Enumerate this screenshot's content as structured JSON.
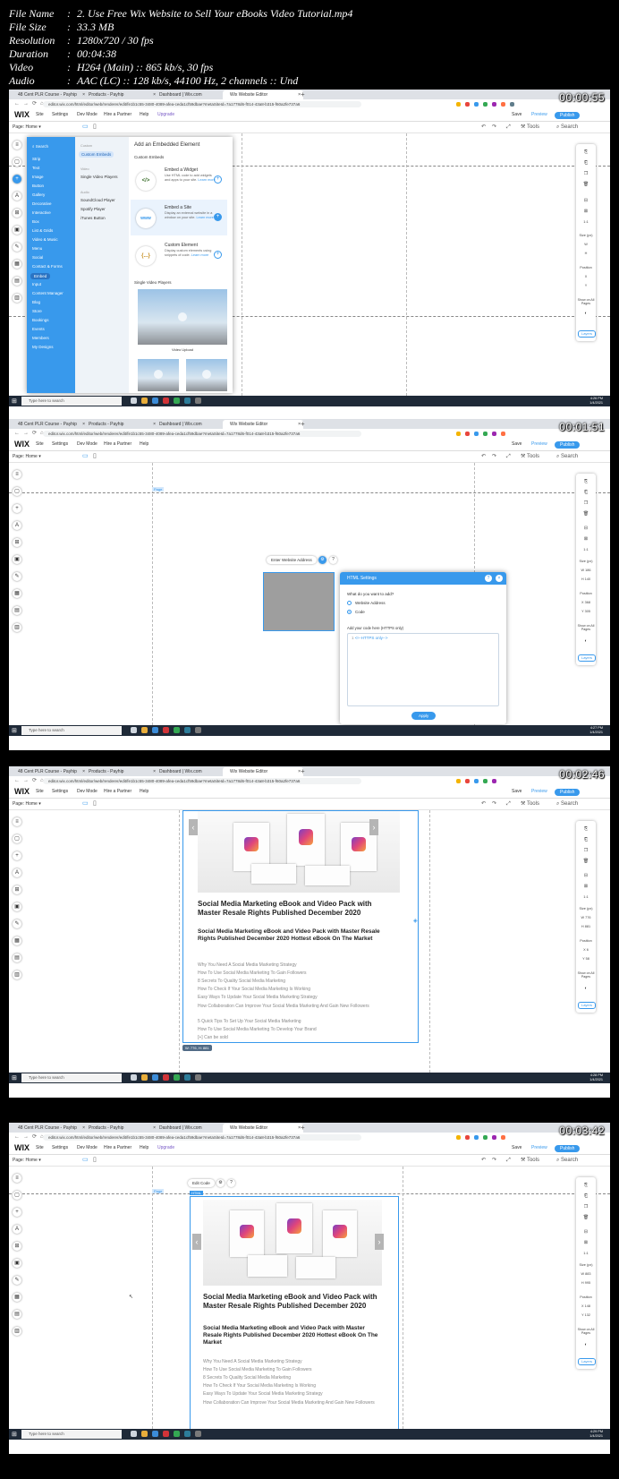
{
  "meta": {
    "file_name": "2. Use Free Wix Website to Sell Your eBooks Video Tutorial.mp4",
    "file_size": "33.3 MB",
    "resolution": "1280x720 / 30 fps",
    "duration": "00:04:38",
    "video": "H264 (Main) :: 865 kb/s, 30 fps",
    "audio": "AAC (LC) :: 128 kb/s, 44100 Hz, 2 channels :: Und",
    "labels": {
      "file_name": "File Name",
      "file_size": "File Size",
      "resolution": "Resolution",
      "duration": "Duration",
      "video": "Video",
      "audio": "Audio"
    }
  },
  "browser": {
    "tabs": [
      "48 Cent PLR Course - Payhip",
      "Products - Payhip",
      "Dashboard | Wix.com",
      "Wix Website Editor"
    ],
    "url_1": "editor.wix.com/html/editor/web/renderer/edit/fe1b1c55-3480-4089-afea-ceda1cf59dbae?metaSiteId=7a1778d6-f014-43a8-b315-f60a2fe737a6",
    "url_2": "editor.wix.com/html/editor/web/renderer/edit/fe1b1c55-3480-4089-afea-ceda1cf59dbae?metaSiteId=7a1778d6-f014-43a8-b315-f60a2fe737a6",
    "url_3": "editor.wix.com/html/editor/web/renderer/edit/fe1b1c55-3480-4089-afea-ceda1cf59dbae?metaSiteId=7a1778d6-f014-43a8-b315-f60a2fe737a6",
    "url_4": "editor.wix.com/html/editor/web/renderer/edit/fe1b1c55-3480-4089-afea-ceda1cf59dbae?metaSiteId=7a1778d6-f014-43a8-b315-f60a2fe737a6"
  },
  "wix": {
    "logo": "WIX",
    "menu": [
      "Site",
      "Settings",
      "Dev Mode",
      "Hire a Partner",
      "Help",
      "Upgrade"
    ],
    "save": "Save",
    "preview": "Preview",
    "publish": "Publish",
    "page_label": "Page:",
    "page_name": "Home",
    "tools": "Tools",
    "search": "Search",
    "page_tag": "Page",
    "html_tag": "HTML"
  },
  "add_panel": {
    "search": "Search",
    "categories": [
      "Strip",
      "Text",
      "Image",
      "Button",
      "Gallery",
      "Decorative",
      "Interactive",
      "Box",
      "List & Grids",
      "Video & Music",
      "Menu",
      "Social",
      "Contact & Forms",
      "Embed",
      "Input",
      "Content Manager",
      "Blog",
      "Store",
      "Bookings",
      "Events",
      "Members",
      "My Designs"
    ],
    "selected_category": "Embed",
    "sub_heads": [
      "Custom",
      "Video",
      "Audio"
    ],
    "sub_items": [
      "Custom Embeds",
      "Single Video Players",
      "SoundCloud Player",
      "Spotify Player",
      "iTunes Button"
    ],
    "title": "Add an Embedded Element",
    "section_custom": "Custom Embeds",
    "cards": [
      {
        "title": "Embed a Widget",
        "desc": "Use HTML code to add widgets and apps to your site.",
        "more": "Learn more"
      },
      {
        "title": "Embed a Site",
        "desc": "Display an external website in a window on your site.",
        "more": "Learn more"
      },
      {
        "title": "Custom Element",
        "desc": "Display custom elements using snippets of code.",
        "more": "Learn more"
      }
    ],
    "section_video": "Single Video Players",
    "video_caption": "Video Upload"
  },
  "inspector": {
    "size_label": "Size (px)",
    "w_label": "W",
    "h_label": "H",
    "position_label": "Position",
    "x_label": "X",
    "y_label": "Y",
    "show_all_pages": "Show on All Pages",
    "layers": "Layers",
    "ratio": "1:1",
    "frame2": {
      "w": "186",
      "h": "140",
      "x": "368",
      "y": "305"
    },
    "frame3": {
      "w": "776",
      "h": "881",
      "x": "6",
      "y": "58"
    },
    "frame4": {
      "w": "883",
      "h": "995",
      "x": "148",
      "y": "132"
    }
  },
  "html_settings": {
    "enter_website": "Enter Website Address",
    "title": "HTML Settings",
    "question": "What do you want to add?",
    "opt_website": "Website Address",
    "opt_code": "Code",
    "code_label": "Add your code here (HTTPS only)",
    "code_value": "<!--HTTPS only-->",
    "apply": "Apply"
  },
  "edit_code": "Edit Code",
  "product": {
    "title": "Social Media Marketing eBook and Video Pack with Master Resale Rights Published December 2020",
    "subtitle": "Social Media Marketing eBook and Video Pack with Master Resale Rights Published December 2020 Hottest eBook On The Market",
    "bullets": [
      "Why You Need A Social Media Marketing Strategy",
      "How To Use Social Media Marketing To Gain Followers",
      "8 Secrets To Quality Social Media Marketing",
      "How To Check If Your Social Media Marketing Is Working",
      "Easy Ways To Update Your Social Media Marketing Strategy",
      "How Collaboration Can Improve Your Social Media Marketing And Gain New Followers",
      "5 Quick Tips To Set Up Your Social Media Marketing",
      "How To Use Social Media Marketing To Develop Your Brand",
      "[+] Can be sold"
    ],
    "size_chip": "W: 776, H: 881"
  },
  "taskbar": {
    "search": "Type here to search",
    "clocks": [
      {
        "time": "4:26 PM",
        "date": "1/4/2021"
      },
      {
        "time": "4:27 PM",
        "date": "1/4/2021"
      },
      {
        "time": "4:28 PM",
        "date": "1/4/2021"
      },
      {
        "time": "4:29 PM",
        "date": "1/4/2021"
      }
    ]
  },
  "timestamps": [
    "00:00:55",
    "00:01:51",
    "00:02:46",
    "00:03:42"
  ],
  "colors": {
    "accent": "#3899ec",
    "taskbar": "#1f2a38",
    "tab_bar": "#dee1e6"
  }
}
